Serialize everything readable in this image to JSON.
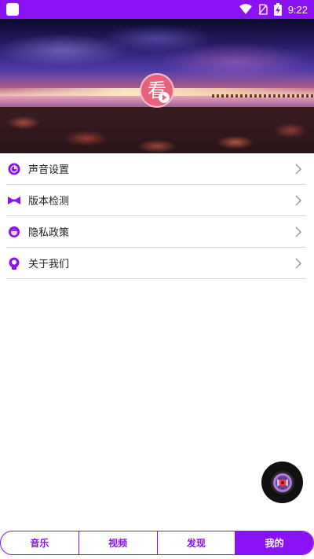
{
  "status_bar": {
    "time": "9:22",
    "icons": [
      "app-icon",
      "wifi-icon",
      "no-sim-icon",
      "battery-charging-icon"
    ]
  },
  "banner": {
    "logo_text": "看",
    "logo_icon": "play-icon"
  },
  "menu": {
    "items": [
      {
        "label": "声音设置",
        "icon": "sound-settings-icon"
      },
      {
        "label": "版本检测",
        "icon": "version-check-icon"
      },
      {
        "label": "隐私政策",
        "icon": "privacy-policy-icon"
      },
      {
        "label": "关于我们",
        "icon": "about-us-icon"
      }
    ]
  },
  "tabs": [
    {
      "label": "音乐",
      "active": false
    },
    {
      "label": "视频",
      "active": false
    },
    {
      "label": "发现",
      "active": false
    },
    {
      "label": "我的",
      "active": true
    }
  ],
  "colors": {
    "accent": "#8a12f5",
    "logo_bg": "#e8617a"
  }
}
